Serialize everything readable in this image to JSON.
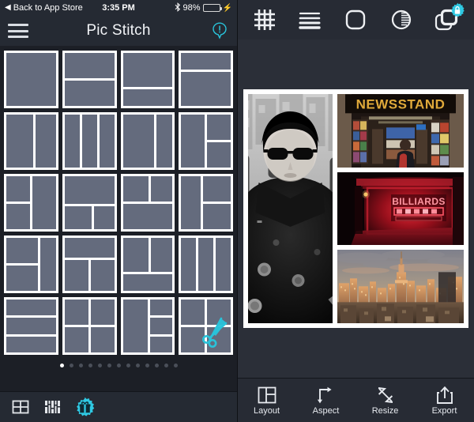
{
  "status_bar": {
    "back_label": "Back to App Store",
    "back_caret": "◀",
    "time": "3:35 PM",
    "bluetooth_icon": "bluetooth-icon",
    "battery_percent": "98%",
    "battery_level": 98,
    "charging_icon": "⚡"
  },
  "nav_bar": {
    "menu_icon": "hamburger-menu-icon",
    "title": "Pic Stitch",
    "info_icon": "info-alert-icon"
  },
  "layouts": {
    "rows": [
      [
        {
          "name": "layout-1-single",
          "cells": 1
        },
        {
          "name": "layout-2-stacked",
          "cells": 2
        },
        {
          "name": "layout-2-top-large",
          "cells": 2
        },
        {
          "name": "layout-2-bottom-large",
          "cells": 2
        }
      ],
      [
        {
          "name": "layout-2-vertical-split",
          "cells": 2
        },
        {
          "name": "layout-3-columns",
          "cells": 3
        },
        {
          "name": "layout-2-wide-narrow",
          "cells": 2
        },
        {
          "name": "layout-3-left-right-split",
          "cells": 3
        }
      ],
      [
        {
          "name": "layout-3-left-stack",
          "cells": 3
        },
        {
          "name": "layout-3-top-wide",
          "cells": 3
        },
        {
          "name": "layout-3-top-two",
          "cells": 3
        },
        {
          "name": "layout-3-left-tall",
          "cells": 3
        }
      ],
      [
        {
          "name": "layout-3-right-tall",
          "cells": 3
        },
        {
          "name": "layout-3-top-bar",
          "cells": 3
        },
        {
          "name": "layout-3-bottom-bar",
          "cells": 3
        },
        {
          "name": "layout-3-even-columns",
          "cells": 3
        }
      ],
      [
        {
          "name": "layout-3-rows",
          "cells": 3
        },
        {
          "name": "layout-4-quad",
          "cells": 4
        },
        {
          "name": "layout-4-left-right-stack",
          "cells": 4
        },
        {
          "name": "layout-4-scissors-featured",
          "cells": 4
        }
      ]
    ],
    "page_dots": {
      "count": 13,
      "active_index": 0
    }
  },
  "left_toolbar": {
    "items": [
      {
        "name": "grid-layout-icon",
        "label": "Layouts"
      },
      {
        "name": "collage-pattern-icon",
        "label": "Patterns"
      },
      {
        "name": "gift-badge-icon",
        "label": "Gift"
      }
    ]
  },
  "edit_toolbar": {
    "items": [
      {
        "name": "grid-lattice-icon",
        "label": "Grid"
      },
      {
        "name": "border-lines-icon",
        "label": "Borders"
      },
      {
        "name": "rounded-corners-icon",
        "label": "Corners"
      },
      {
        "name": "shadow-gradient-icon",
        "label": "Shadow"
      },
      {
        "name": "stacked-frames-icon",
        "label": "Frames",
        "badge": "lock-badge-icon"
      }
    ]
  },
  "collage": {
    "photos": [
      {
        "name": "photo-portrait-bw",
        "alt": "Black and white portrait of person in sunglasses and coat on a city street",
        "position": "left-tall"
      },
      {
        "name": "photo-newsstand",
        "alt": "Newsstand storefront with gold NEWSSTAND sign",
        "sign_text": "NEWSSTAND",
        "position": "right-top"
      },
      {
        "name": "photo-billiards-neon",
        "alt": "Dark red-lit room with BILLIARDS neon sign",
        "sign_text": "BILLIARDS",
        "position": "right-middle"
      },
      {
        "name": "photo-nyc-skyline",
        "alt": "New York City skyline at golden hour with Empire State Building",
        "position": "right-bottom"
      }
    ],
    "border_color": "#ffffff"
  },
  "bottom_toolbar": {
    "items": [
      {
        "name": "layout-button",
        "label": "Layout",
        "icon": "layout-grid-icon"
      },
      {
        "name": "aspect-button",
        "label": "Aspect",
        "icon": "aspect-arrow-icon"
      },
      {
        "name": "resize-button",
        "label": "Resize",
        "icon": "resize-diagonal-icon"
      },
      {
        "name": "export-button",
        "label": "Export",
        "icon": "export-share-icon"
      }
    ]
  },
  "colors": {
    "accent_teal": "#29c3da",
    "panel_dark": "#1c1f26",
    "bar_dark": "#252a33",
    "cell_gray": "#646b7d",
    "battery_green": "#4cd964"
  }
}
